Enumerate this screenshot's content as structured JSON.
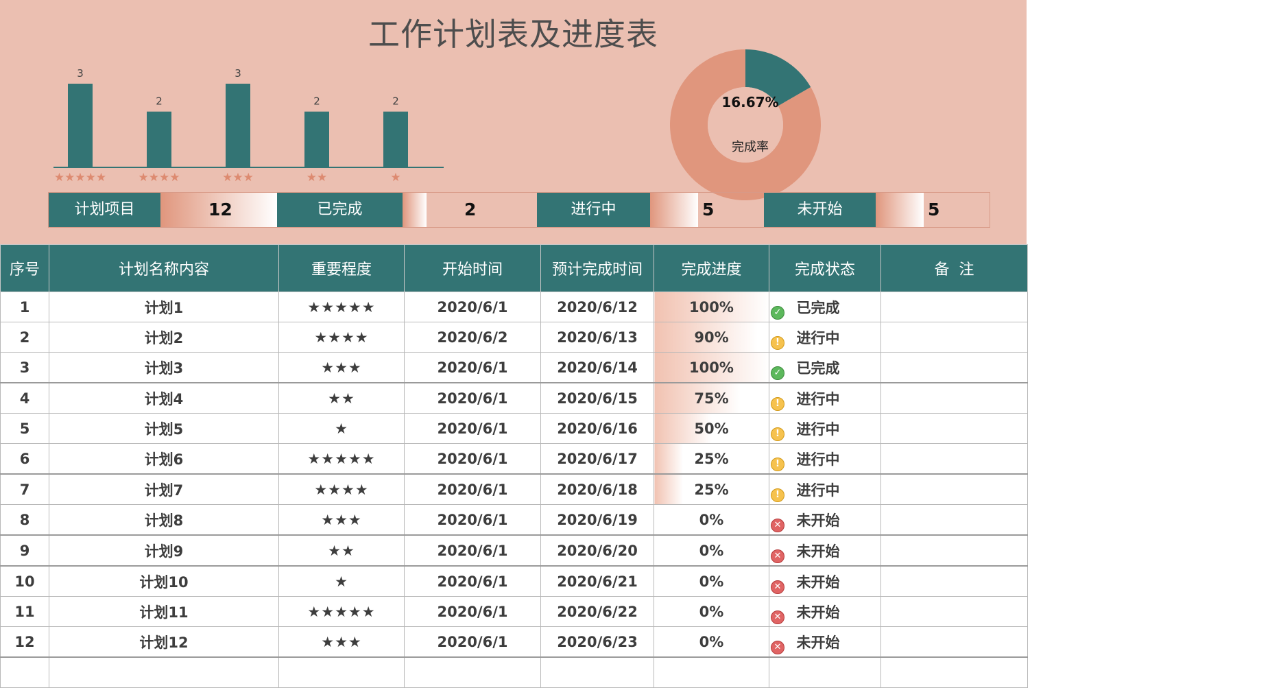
{
  "title": "工作计划表及进度表",
  "colors": {
    "teal": "#337474",
    "salmon": "#e0967d",
    "header_bg": "#ebbfb1",
    "star": "#dd8a70"
  },
  "chart_data": [
    {
      "type": "bar",
      "categories": [
        "★★★★★",
        "★★★★",
        "★★★",
        "★★",
        "★"
      ],
      "values": [
        3,
        2,
        3,
        2,
        2
      ],
      "title": "",
      "xlabel": "",
      "ylabel": "",
      "ylim": [
        0,
        3
      ],
      "grid": false
    },
    {
      "type": "pie",
      "donut": true,
      "slices": [
        {
          "label": "",
          "value": 16.67,
          "color": "#337474"
        },
        {
          "label": "",
          "value": 83.33,
          "color": "#e0967d"
        }
      ],
      "center_value": "16.67%",
      "center_label": "完成率"
    }
  ],
  "summary": {
    "planned": {
      "label": "计划项目",
      "value": "12"
    },
    "done": {
      "label": "已完成",
      "value": "2"
    },
    "doing": {
      "label": "进行中",
      "value": "5"
    },
    "todo": {
      "label": "未开始",
      "value": "5"
    }
  },
  "table": {
    "headers": [
      "序号",
      "计划名称内容",
      "重要程度",
      "开始时间",
      "预计完成时间",
      "完成进度",
      "完成状态",
      "备  注"
    ],
    "rows": [
      {
        "no": "1",
        "name": "计划1",
        "stars": "★★★★★",
        "start": "2020/6/1",
        "end": "2020/6/12",
        "progress": "100%",
        "pct": 1.0,
        "status": "已完成",
        "icon": "check-icon"
      },
      {
        "no": "2",
        "name": "计划2",
        "stars": "★★★★",
        "start": "2020/6/2",
        "end": "2020/6/13",
        "progress": "90%",
        "pct": 0.9,
        "status": "进行中",
        "icon": "warning-icon"
      },
      {
        "no": "3",
        "name": "计划3",
        "stars": "★★★",
        "start": "2020/6/1",
        "end": "2020/6/14",
        "progress": "100%",
        "pct": 1.0,
        "status": "已完成",
        "icon": "check-icon"
      },
      {
        "no": "4",
        "name": "计划4",
        "stars": "★★",
        "start": "2020/6/1",
        "end": "2020/6/15",
        "progress": "75%",
        "pct": 0.75,
        "status": "进行中",
        "icon": "warning-icon"
      },
      {
        "no": "5",
        "name": "计划5",
        "stars": "★",
        "start": "2020/6/1",
        "end": "2020/6/16",
        "progress": "50%",
        "pct": 0.5,
        "status": "进行中",
        "icon": "warning-icon"
      },
      {
        "no": "6",
        "name": "计划6",
        "stars": "★★★★★",
        "start": "2020/6/1",
        "end": "2020/6/17",
        "progress": "25%",
        "pct": 0.25,
        "status": "进行中",
        "icon": "warning-icon"
      },
      {
        "no": "7",
        "name": "计划7",
        "stars": "★★★★",
        "start": "2020/6/1",
        "end": "2020/6/18",
        "progress": "25%",
        "pct": 0.25,
        "status": "进行中",
        "icon": "warning-icon"
      },
      {
        "no": "8",
        "name": "计划8",
        "stars": "★★★",
        "start": "2020/6/1",
        "end": "2020/6/19",
        "progress": "0%",
        "pct": 0,
        "status": "未开始",
        "icon": "cross-icon"
      },
      {
        "no": "9",
        "name": "计划9",
        "stars": "★★",
        "start": "2020/6/1",
        "end": "2020/6/20",
        "progress": "0%",
        "pct": 0,
        "status": "未开始",
        "icon": "cross-icon"
      },
      {
        "no": "10",
        "name": "计划10",
        "stars": "★",
        "start": "2020/6/1",
        "end": "2020/6/21",
        "progress": "0%",
        "pct": 0,
        "status": "未开始",
        "icon": "cross-icon"
      },
      {
        "no": "11",
        "name": "计划11",
        "stars": "★★★★★",
        "start": "2020/6/1",
        "end": "2020/6/22",
        "progress": "0%",
        "pct": 0,
        "status": "未开始",
        "icon": "cross-icon"
      },
      {
        "no": "12",
        "name": "计划12",
        "stars": "★★★",
        "start": "2020/6/1",
        "end": "2020/6/23",
        "progress": "0%",
        "pct": 0,
        "status": "未开始",
        "icon": "cross-icon"
      }
    ]
  }
}
